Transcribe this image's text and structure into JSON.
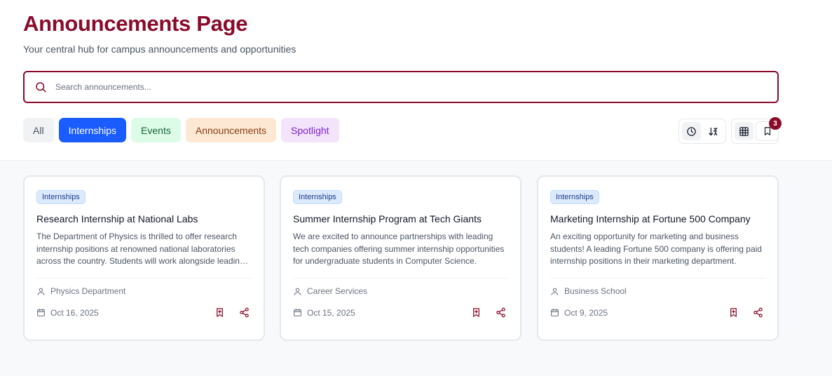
{
  "header": {
    "title": "Announcements Page",
    "subtitle": "Your central hub for campus announcements and opportunities"
  },
  "search": {
    "placeholder": "Search announcements..."
  },
  "filters": [
    "All",
    "Internships",
    "Events",
    "Announcements",
    "Spotlight"
  ],
  "active_filter": "Internships",
  "bookmarks": {
    "count": "3"
  },
  "toolbar": {
    "sort_icons": [
      "clock-icon",
      "sort-icon"
    ],
    "view_icons": [
      "grid-icon",
      "list-icon"
    ],
    "active_sort": "clock-icon",
    "active_view": "grid-icon"
  },
  "colors": {
    "brand": "#8b0a2a",
    "active_chip": "#1a5cff",
    "background": "#f8f9fb"
  },
  "cards": [
    {
      "tag": "Internships",
      "title": "Research Internship at National Labs",
      "description": "The Department of Physics is thrilled to offer research internship positions at renowned national laboratories across the country. Students will work alongside leading scientists.",
      "author": "Physics Department",
      "date": "Oct 16, 2025"
    },
    {
      "tag": "Internships",
      "title": "Summer Internship Program at Tech Giants",
      "description": "We are excited to announce partnerships with leading tech companies offering summer internship opportunities for undergraduate students in Computer Science.",
      "author": "Career Services",
      "date": "Oct 15, 2025"
    },
    {
      "tag": "Internships",
      "title": "Marketing Internship at Fortune 500 Company",
      "description": "An exciting opportunity for marketing and business students! A leading Fortune 500 company is offering paid internship positions in their marketing department.",
      "author": "Business School",
      "date": "Oct 9, 2025"
    }
  ]
}
